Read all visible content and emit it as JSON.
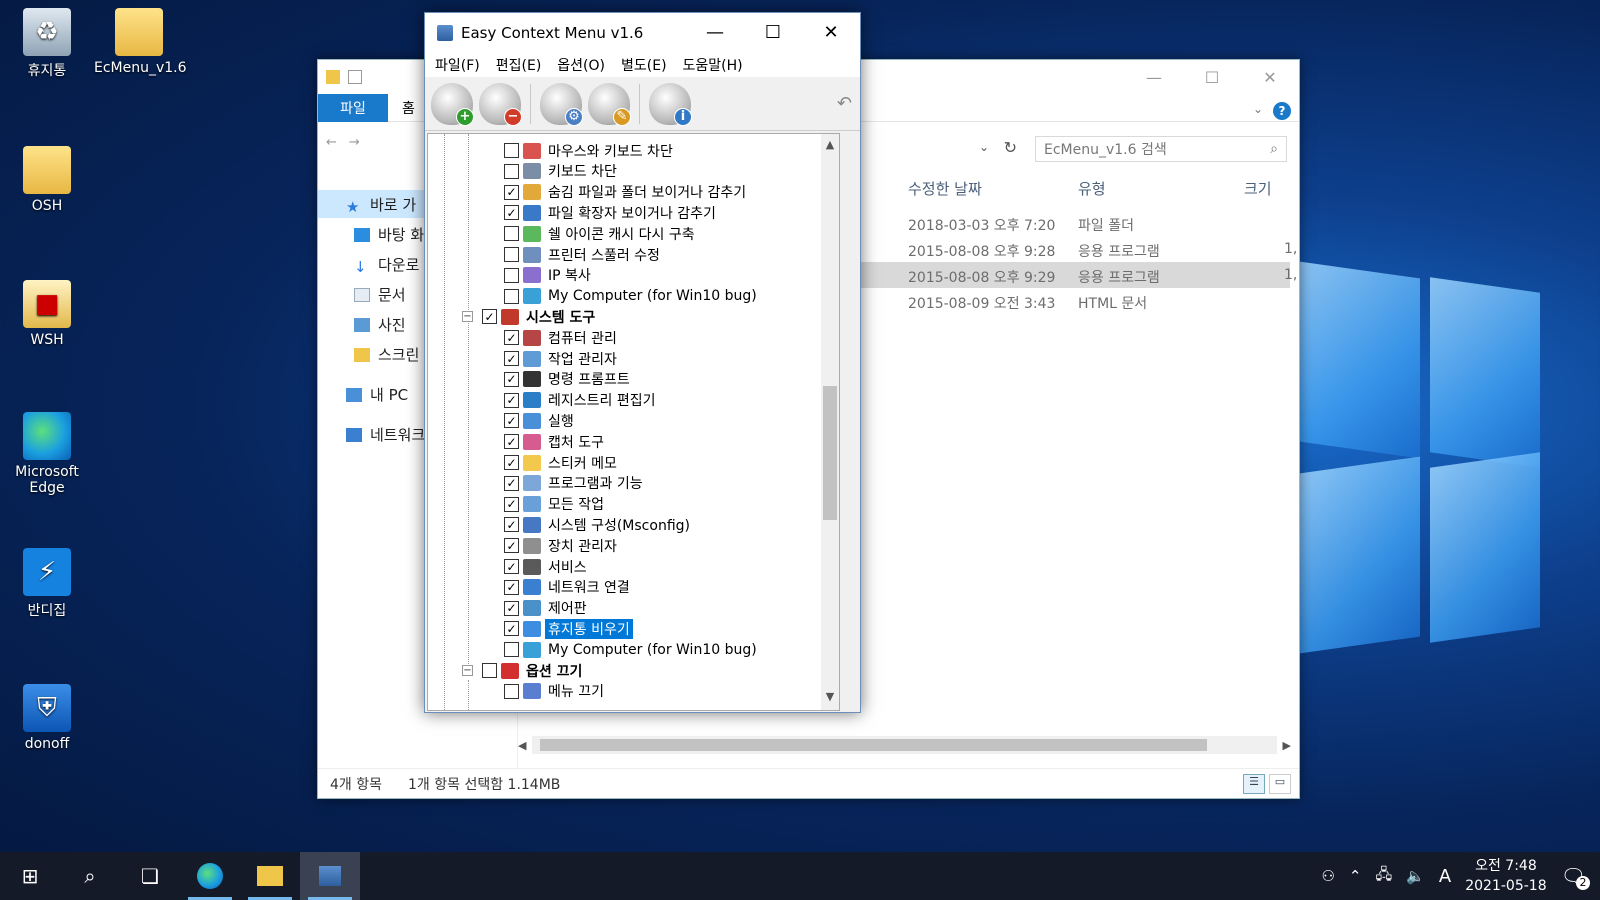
{
  "desktop": {
    "icons": [
      {
        "label": "휴지통",
        "icon": "recycle-bin-icon"
      },
      {
        "label": "EcMenu_v1.6",
        "icon": "folder-icon"
      },
      {
        "label": "OSH",
        "icon": "folder-icon"
      },
      {
        "label": "WSH",
        "icon": "document-icon"
      },
      {
        "label": "Microsoft Edge",
        "icon": "edge-icon"
      },
      {
        "label": "반디집",
        "icon": "bandizip-icon"
      },
      {
        "label": "donoff",
        "icon": "shield-icon"
      }
    ]
  },
  "explorer": {
    "ribbon": {
      "file_tab": "파일",
      "home_tab": "홈",
      "help": "?"
    },
    "search_placeholder": "EcMenu_v1.6 검색",
    "nav": {
      "quick_access": "바로 가",
      "items": [
        "바탕 화",
        "다운로",
        "문서",
        "사진",
        "스크린"
      ],
      "this_pc": "내 PC",
      "network": "네트워크"
    },
    "columns": {
      "modified": "수정한 날짜",
      "type": "유형",
      "size": "크기"
    },
    "rows": [
      {
        "modified": "2018-03-03 오후 7:20",
        "type": "파일 폴더",
        "size": ""
      },
      {
        "modified": "2015-08-08 오후 9:28",
        "type": "응용 프로그램",
        "size": "1,"
      },
      {
        "modified": "2015-08-08 오후 9:29",
        "type": "응용 프로그램",
        "size": "1,"
      },
      {
        "modified": "2015-08-09 오전 3:43",
        "type": "HTML 문서",
        "size": ""
      }
    ],
    "status": {
      "count": "4개 항목",
      "selection": "1개 항목 선택함 1.14MB"
    }
  },
  "ecm": {
    "title": "Easy Context Menu v1.6",
    "menu": [
      "파일(F)",
      "편집(E)",
      "옵션(O)",
      "별도(E)",
      "도움말(H)"
    ],
    "toolbar": [
      {
        "name": "add-item-button",
        "badge": "+",
        "color": "#2e9d2e"
      },
      {
        "name": "remove-item-button",
        "badge": "−",
        "color": "#d23a2a"
      },
      {
        "name": "settings-button",
        "badge": "⚙",
        "color": "#4a7fc4"
      },
      {
        "name": "cleanup-button",
        "badge": "✎",
        "color": "#d99a22"
      },
      {
        "name": "about-button",
        "badge": "i",
        "color": "#3178c6"
      }
    ],
    "tree": [
      {
        "label": "마우스와 키보드 차단",
        "checked": false,
        "level": 2
      },
      {
        "label": "키보드 차단",
        "checked": false,
        "level": 2
      },
      {
        "label": "숨김 파일과 폴더 보이거나 감추기",
        "checked": true,
        "level": 2
      },
      {
        "label": "파일 확장자 보이거나 감추기",
        "checked": true,
        "level": 2
      },
      {
        "label": "쉘 아이콘 캐시 다시 구축",
        "checked": false,
        "level": 2
      },
      {
        "label": "프린터 스풀러 수정",
        "checked": false,
        "level": 2
      },
      {
        "label": "IP 복사",
        "checked": false,
        "level": 2
      },
      {
        "label": "My Computer (for Win10 bug)",
        "checked": false,
        "level": 2
      },
      {
        "label": "시스템 도구",
        "checked": true,
        "level": 1,
        "group": true
      },
      {
        "label": "컴퓨터 관리",
        "checked": true,
        "level": 2
      },
      {
        "label": "작업 관리자",
        "checked": true,
        "level": 2
      },
      {
        "label": "명령 프롬프트",
        "checked": true,
        "level": 2
      },
      {
        "label": "레지스트리 편집기",
        "checked": true,
        "level": 2
      },
      {
        "label": "실행",
        "checked": true,
        "level": 2
      },
      {
        "label": "캡처 도구",
        "checked": true,
        "level": 2
      },
      {
        "label": "스티커 메모",
        "checked": true,
        "level": 2
      },
      {
        "label": "프로그램과 기능",
        "checked": true,
        "level": 2
      },
      {
        "label": "모든 작업",
        "checked": true,
        "level": 2
      },
      {
        "label": "시스템 구성(Msconfig)",
        "checked": true,
        "level": 2
      },
      {
        "label": "장치 관리자",
        "checked": true,
        "level": 2
      },
      {
        "label": "서비스",
        "checked": true,
        "level": 2
      },
      {
        "label": "네트워크 연결",
        "checked": true,
        "level": 2
      },
      {
        "label": "제어판",
        "checked": true,
        "level": 2
      },
      {
        "label": "휴지통 비우기",
        "checked": true,
        "level": 2,
        "selected": true
      },
      {
        "label": "My Computer (for Win10 bug)",
        "checked": false,
        "level": 2
      },
      {
        "label": "옵션 끄기",
        "checked": false,
        "level": 1,
        "group": true
      },
      {
        "label": "메뉴 끄기",
        "checked": false,
        "level": 2
      }
    ]
  },
  "taskbar": {
    "time": "오전 7:48",
    "date": "2021-05-18",
    "ime": "A",
    "notification_count": "2"
  }
}
